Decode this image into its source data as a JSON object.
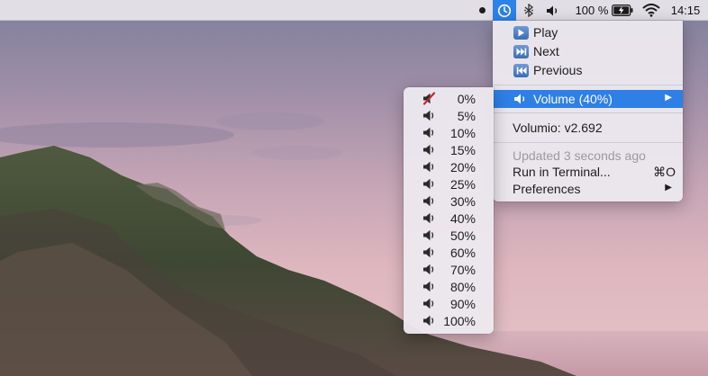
{
  "menubar": {
    "volumio_icon": "volumio-icon",
    "bluetooth_icon": "bluetooth-icon",
    "speaker_icon": "speaker-icon",
    "battery_percent": "100 %",
    "battery_icon": "battery-charging-icon",
    "wifi_icon": "wifi-icon",
    "clock": "14:15"
  },
  "main_menu": {
    "play_label": "Play",
    "next_label": "Next",
    "previous_label": "Previous",
    "volume_label": "Volume (40%)",
    "version_label": "Volumio: v2.692",
    "updated_label": "Updated 3 seconds ago",
    "terminal_label": "Run in Terminal...",
    "terminal_shortcut": "⌘O",
    "preferences_label": "Preferences",
    "submenu_arrow": "▶"
  },
  "volume_menu": {
    "items": [
      "0%",
      "5%",
      "10%",
      "15%",
      "20%",
      "25%",
      "30%",
      "40%",
      "50%",
      "60%",
      "70%",
      "80%",
      "90%",
      "100%"
    ]
  },
  "colors": {
    "highlight": "#2e7fe6",
    "menubar_active": "#2d82e8"
  }
}
